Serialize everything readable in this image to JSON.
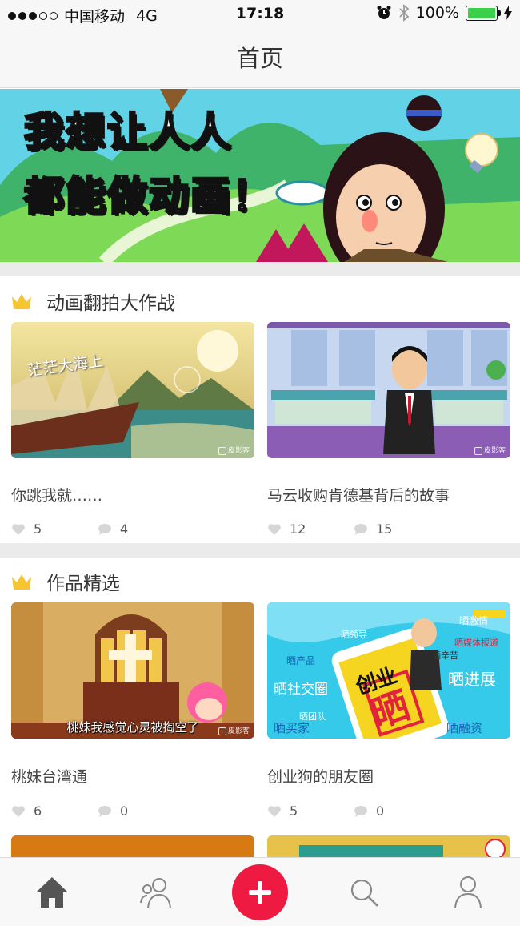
{
  "status_bar": {
    "carrier": "中国移动",
    "network": "4G",
    "time": "17:18",
    "battery": "100%",
    "signal_bars_filled": 3,
    "signal_bars_total": 5
  },
  "nav": {
    "title": "首页"
  },
  "banner": {
    "line1": "我想让人人",
    "line2": "都能做动画！"
  },
  "sections": [
    {
      "title": "动画翻拍大作战",
      "cards": [
        {
          "title": "你跳我就……",
          "likes": "5",
          "comments": "4",
          "caption": "茫茫大海上",
          "watermark": "皮影客"
        },
        {
          "title": "马云收购肯德基背后的故事",
          "likes": "12",
          "comments": "15",
          "caption": "",
          "watermark": "皮影客"
        }
      ]
    },
    {
      "title": "作品精选",
      "cards": [
        {
          "title": "桃妹台湾通",
          "likes": "6",
          "comments": "0",
          "caption": "桃妹我感觉心灵被掏空了",
          "watermark": "皮影客"
        },
        {
          "title": "创业狗的朋友圈",
          "likes": "5",
          "comments": "0",
          "caption": "",
          "watermark": ""
        }
      ]
    }
  ],
  "poster_labels": {
    "center_top": "创业",
    "center_big": "晒",
    "tags": [
      "晒激情",
      "晒媒体报道",
      "晒辛苦",
      "晒产品",
      "晒社交圈",
      "晒进展",
      "晒团队",
      "晒买家",
      "晒融资",
      "晒领导"
    ]
  },
  "icons": {
    "home": "home-icon",
    "friends": "friends-icon",
    "create": "plus-icon",
    "search": "search-icon",
    "profile": "profile-icon",
    "like": "heart-icon",
    "comment": "comment-icon",
    "crown": "crown-icon"
  },
  "colors": {
    "accent": "#ee1a41",
    "crown": "#f7c531",
    "battery": "#3ad04b",
    "divider": "#ebebeb"
  }
}
